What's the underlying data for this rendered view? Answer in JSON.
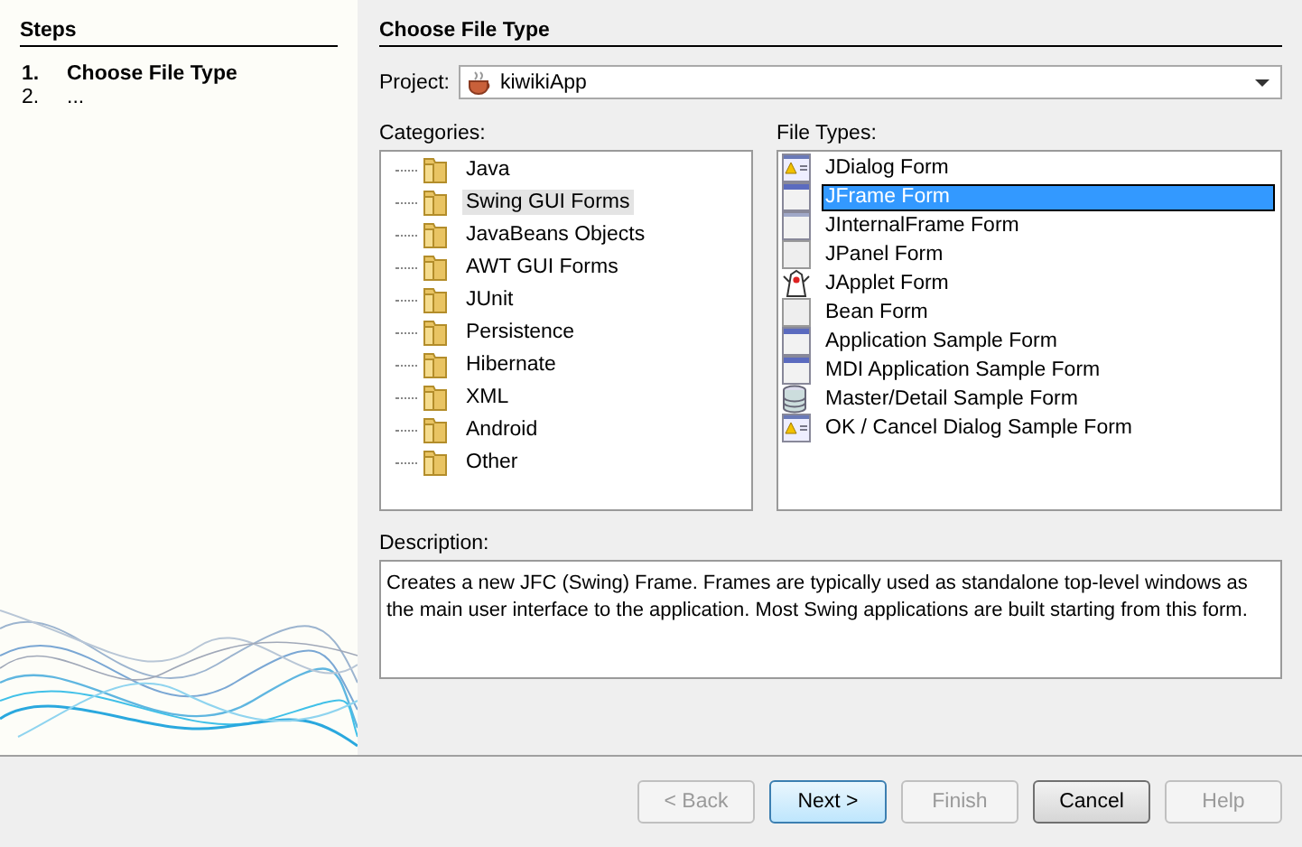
{
  "steps": {
    "title": "Steps",
    "items": [
      {
        "number": "1.",
        "label": "Choose File Type",
        "current": true
      },
      {
        "number": "2.",
        "label": "...",
        "current": false
      }
    ]
  },
  "panel_title": "Choose File Type",
  "project": {
    "label": "Project:",
    "value": "kiwikiApp"
  },
  "categories": {
    "label": "Categories:",
    "items": [
      {
        "label": "Java",
        "selected": false
      },
      {
        "label": "Swing GUI Forms",
        "selected": true
      },
      {
        "label": "JavaBeans Objects",
        "selected": false
      },
      {
        "label": "AWT GUI Forms",
        "selected": false
      },
      {
        "label": "JUnit",
        "selected": false
      },
      {
        "label": "Persistence",
        "selected": false
      },
      {
        "label": "Hibernate",
        "selected": false
      },
      {
        "label": "XML",
        "selected": false
      },
      {
        "label": "Android",
        "selected": false
      },
      {
        "label": "Other",
        "selected": false
      }
    ]
  },
  "file_types": {
    "label": "File Types:",
    "items": [
      {
        "label": "JDialog Form",
        "kind": "dialog",
        "selected": false
      },
      {
        "label": "JFrame Form",
        "kind": "frame",
        "selected": true
      },
      {
        "label": "JInternalFrame Form",
        "kind": "internal",
        "selected": false
      },
      {
        "label": "JPanel Form",
        "kind": "panel",
        "selected": false
      },
      {
        "label": "JApplet Form",
        "kind": "applet",
        "selected": false
      },
      {
        "label": "Bean Form",
        "kind": "panel",
        "selected": false
      },
      {
        "label": "Application Sample Form",
        "kind": "frame",
        "selected": false
      },
      {
        "label": "MDI Application Sample Form",
        "kind": "frame",
        "selected": false
      },
      {
        "label": "Master/Detail Sample Form",
        "kind": "database",
        "selected": false
      },
      {
        "label": "OK / Cancel Dialog Sample Form",
        "kind": "dialog",
        "selected": false
      }
    ]
  },
  "description": {
    "label": "Description:",
    "text": "Creates a new JFC (Swing) Frame. Frames are typically used as standalone top-level windows as the main user interface to the application. Most Swing applications are built starting from this form."
  },
  "buttons": [
    {
      "label": "< Back",
      "disabled": true,
      "default": false
    },
    {
      "label": "Next >",
      "disabled": false,
      "default": true
    },
    {
      "label": "Finish",
      "disabled": true,
      "default": false
    },
    {
      "label": "Cancel",
      "disabled": false,
      "default": false
    },
    {
      "label": "Help",
      "disabled": true,
      "default": false
    }
  ]
}
